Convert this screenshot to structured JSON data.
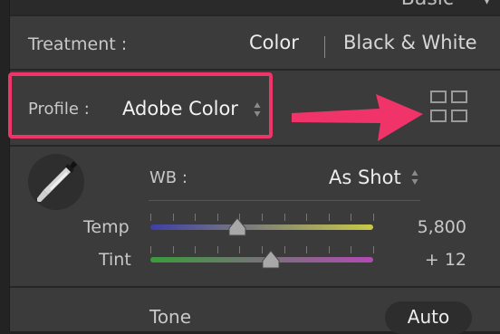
{
  "header": {
    "title": "Basic",
    "collapse_icon": "triangle-down-icon"
  },
  "treatment": {
    "label": "Treatment :",
    "options": [
      "Color",
      "Black & White"
    ],
    "selected": "Color"
  },
  "profile": {
    "label": "Profile :",
    "value": "Adobe Color",
    "stepper_icon": "up-down-stepper-icon",
    "browser_icon": "grid-icon"
  },
  "annotation": {
    "highlight_color": "#f0346a",
    "arrow_color": "#f0346a"
  },
  "white_balance": {
    "label": "WB :",
    "value": "As Shot",
    "eyedropper_icon": "eyedropper-icon",
    "sliders": [
      {
        "label": "Temp",
        "value": "5,800",
        "position": 0.39
      },
      {
        "label": "Tint",
        "value": "+ 12",
        "position": 0.54
      }
    ]
  },
  "tone": {
    "label": "Tone",
    "auto_label": "Auto"
  }
}
